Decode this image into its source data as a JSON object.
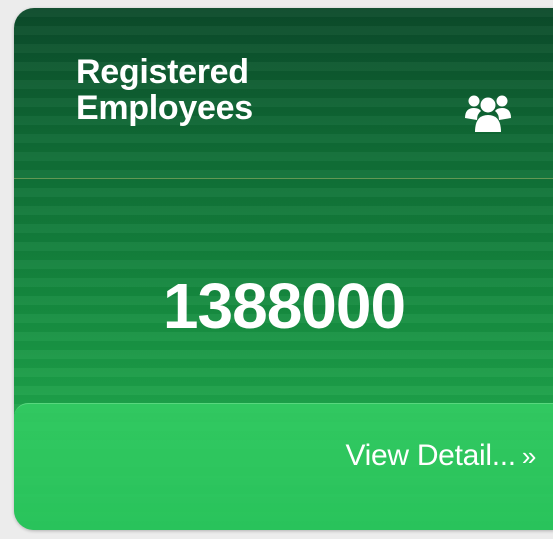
{
  "card": {
    "title": "Registered Employees",
    "value": "1388000",
    "icon": "users-icon",
    "link_label": "View Detail...",
    "link_chevron": "»",
    "colors": {
      "gradient_top": "#0b4a2a",
      "gradient_bottom": "#25b955",
      "footer": "#2ec45e",
      "text": "#ffffff"
    }
  }
}
